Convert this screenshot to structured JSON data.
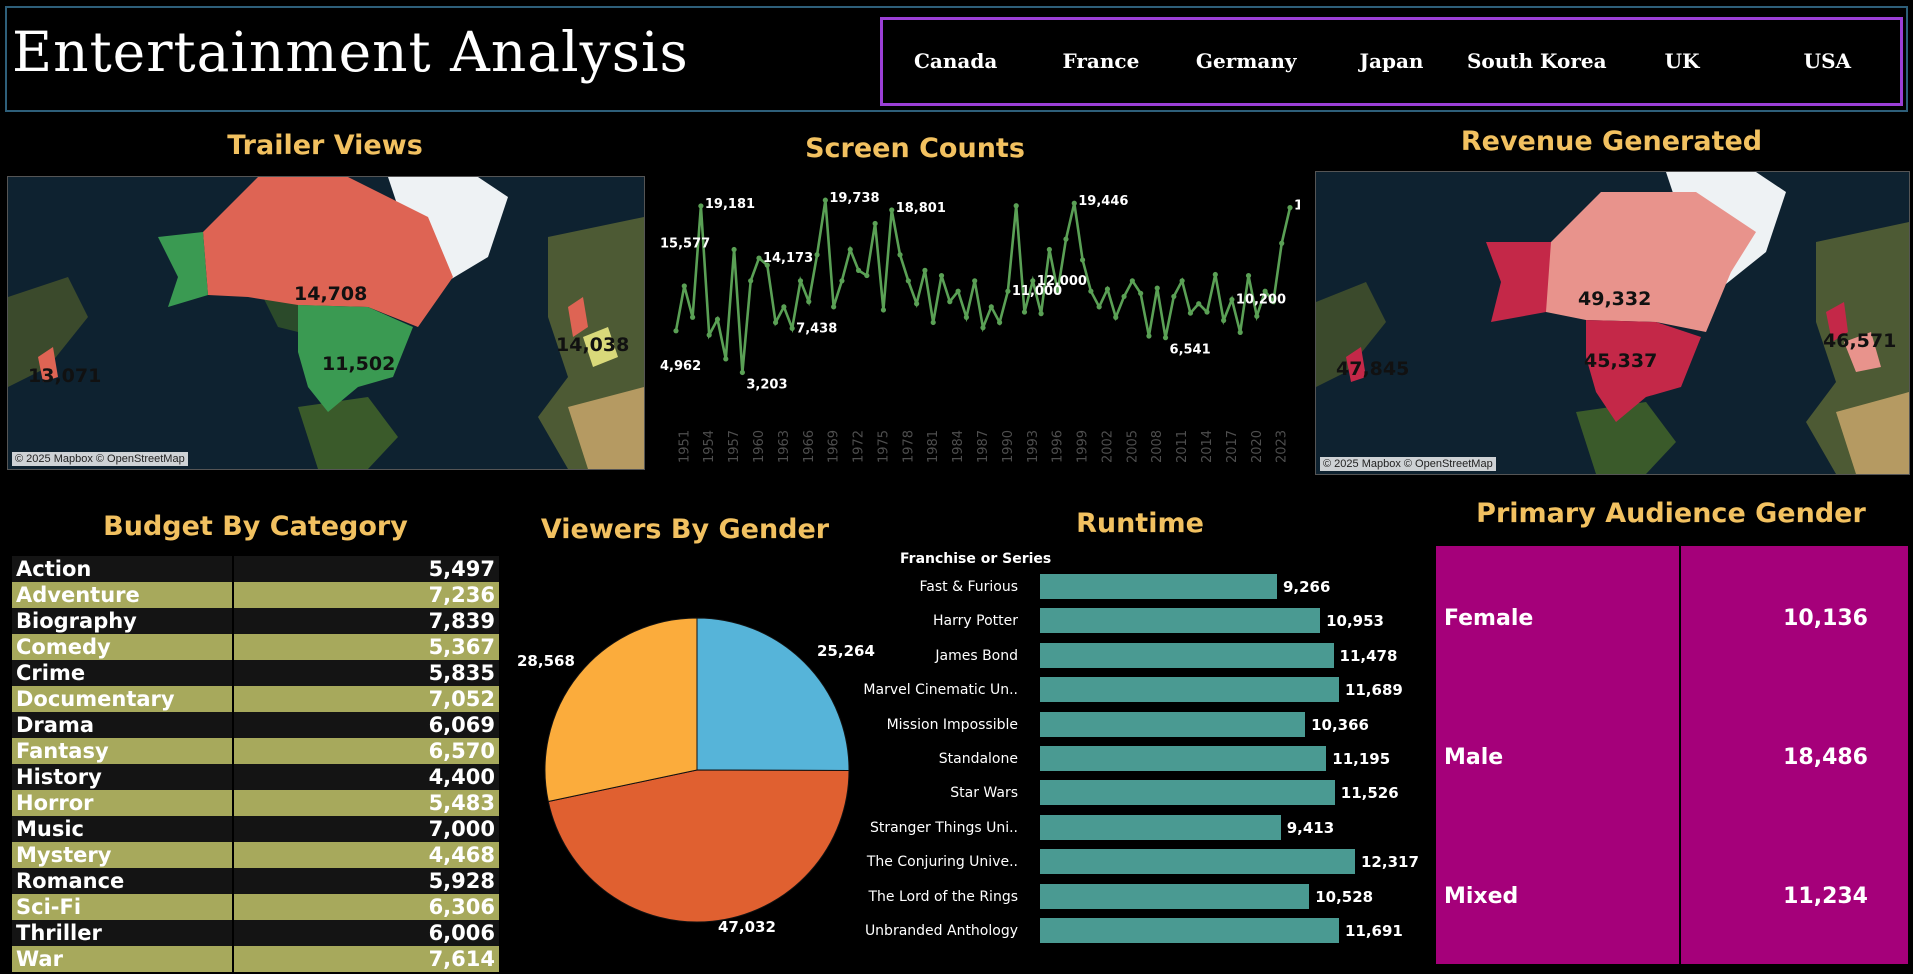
{
  "header": {
    "title": "Entertainment Analysis",
    "countries": [
      "Canada",
      "France",
      "Germany",
      "Japan",
      "South Korea",
      "UK",
      "USA"
    ]
  },
  "trailer_views": {
    "title": "Trailer Views",
    "attribution": "© 2025 Mapbox © OpenStreetMap",
    "labels": [
      "14,708",
      "11,502",
      "14,038",
      "13,071"
    ]
  },
  "revenue": {
    "title": "Revenue Generated",
    "attribution": "© 2025 Mapbox © OpenStreetMap",
    "labels": [
      "49,332",
      "45,337",
      "46,571",
      "47,845"
    ]
  },
  "chart_data": [
    {
      "type": "line",
      "title": "Screen Counts",
      "color": "#5aa055",
      "x": [
        1950,
        1951,
        1952,
        1953,
        1954,
        1955,
        1956,
        1957,
        1958,
        1959,
        1960,
        1961,
        1962,
        1963,
        1964,
        1965,
        1966,
        1967,
        1968,
        1969,
        1970,
        1971,
        1972,
        1973,
        1974,
        1975,
        1976,
        1977,
        1978,
        1979,
        1980,
        1981,
        1982,
        1983,
        1984,
        1985,
        1986,
        1987,
        1988,
        1989,
        1990,
        1991,
        1992,
        1993,
        1994,
        1995,
        1996,
        1997,
        1998,
        1999,
        2000,
        2001,
        2002,
        2003,
        2004,
        2005,
        2006,
        2007,
        2008,
        2009,
        2010,
        2011,
        2012,
        2013,
        2014,
        2015,
        2016,
        2017,
        2018,
        2019,
        2020,
        2021,
        2022,
        2023,
        2024
      ],
      "values": [
        7200,
        11500,
        8500,
        19181,
        6800,
        8300,
        4500,
        15000,
        3203,
        12000,
        14173,
        13500,
        8000,
        9500,
        7438,
        12000,
        10000,
        14500,
        19738,
        9500,
        12000,
        15000,
        13000,
        12500,
        17500,
        9200,
        18801,
        14500,
        12000,
        9800,
        13000,
        8000,
        12500,
        10000,
        11000,
        8500,
        12000,
        7500,
        9500,
        8000,
        11000,
        19200,
        9000,
        12000,
        8851,
        15000,
        11000,
        16000,
        19446,
        14000,
        11000,
        9500,
        11200,
        8500,
        10500,
        12000,
        10800,
        6700,
        11300,
        6541,
        10500,
        12000,
        8900,
        9800,
        9000,
        12600,
        8200,
        10200,
        7050,
        12500,
        8600,
        11000,
        10000,
        15600,
        19020,
        11000,
        15577,
        4962,
        9500
      ],
      "xtick_labels": [
        "1951",
        "1954",
        "1957",
        "1960",
        "1963",
        "1966",
        "1969",
        "1972",
        "1975",
        "1978",
        "1981",
        "1984",
        "1987",
        "1990",
        "1993",
        "1996",
        "1999",
        "2002",
        "2005",
        "2008",
        "2011",
        "2014",
        "2017",
        "2020",
        "2023"
      ],
      "ylim": [
        2000,
        21000
      ]
    },
    {
      "type": "table",
      "title": "Budget By Category",
      "categories": [
        "Action",
        "Adventure",
        "Biography",
        "Comedy",
        "Crime",
        "Documentary",
        "Drama",
        "Fantasy",
        "History",
        "Horror",
        "Music",
        "Mystery",
        "Romance",
        "Sci-Fi",
        "Thriller",
        "War"
      ],
      "values": [
        "5,497",
        "7,236",
        "7,839",
        "5,367",
        "5,835",
        "7,052",
        "6,069",
        "6,570",
        "4,400",
        "5,483",
        "7,000",
        "4,468",
        "5,928",
        "6,306",
        "6,006",
        "7,614"
      ]
    },
    {
      "type": "pie",
      "title": "Viewers By Gender",
      "values": [
        25264,
        47032,
        28568
      ],
      "labels": [
        "25,264",
        "47,032",
        "28,568"
      ],
      "colors": [
        "#56b4d9",
        "#e06030",
        "#fbac3c"
      ]
    },
    {
      "type": "bar",
      "title": "Runtime",
      "header": "Franchise or Series",
      "categories": [
        "Fast & Furious",
        "Harry Potter",
        "James Bond",
        "Marvel Cinematic Un..",
        "Mission Impossible",
        "Standalone",
        "Star Wars",
        "Stranger Things Uni..",
        "The Conjuring Unive..",
        "The Lord of the Rings",
        "Unbranded Anthology"
      ],
      "values": [
        9266,
        10953,
        11478,
        11689,
        10366,
        11195,
        11526,
        9413,
        12317,
        10528,
        11691
      ],
      "labels": [
        "9,266",
        "10,953",
        "11,478",
        "11,689",
        "10,366",
        "11,195",
        "11,526",
        "9,413",
        "12,317",
        "10,528",
        "11,691"
      ],
      "color": "#4a9a92",
      "xlim": [
        0,
        12317
      ]
    },
    {
      "type": "table",
      "title": "Primary Audience Gender",
      "categories": [
        "Female",
        "Male",
        "Mixed"
      ],
      "values": [
        "10,136",
        "18,486",
        "11,234"
      ]
    }
  ]
}
